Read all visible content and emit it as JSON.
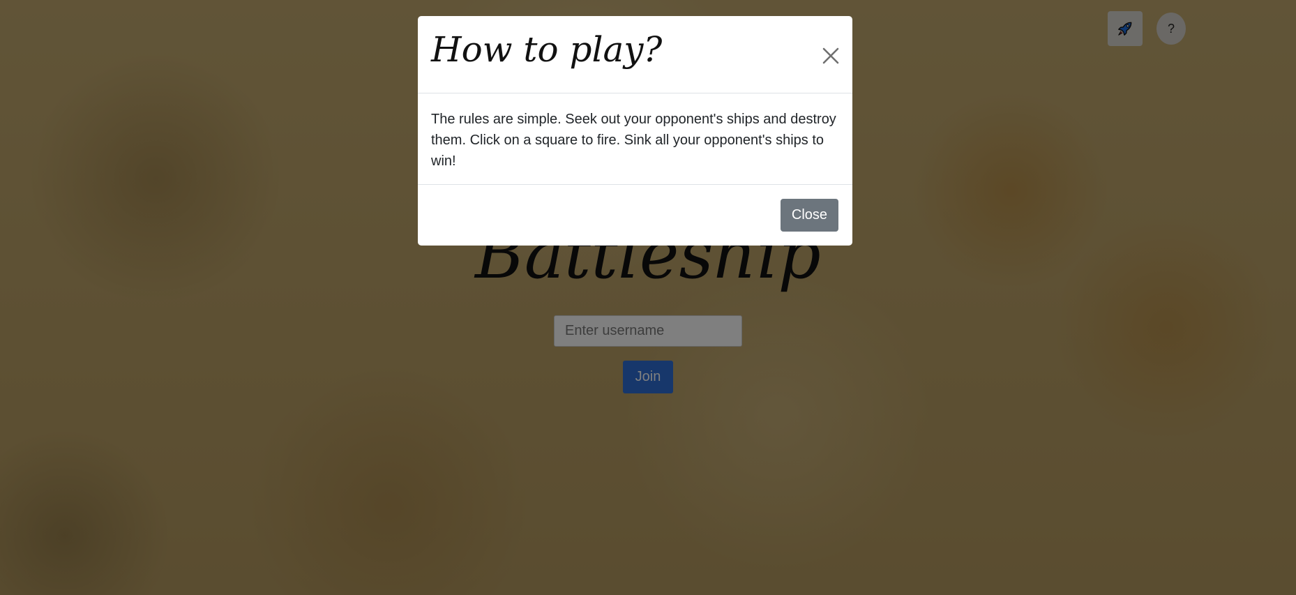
{
  "page": {
    "title": "Battleship",
    "username_placeholder": "Enter username",
    "join_label": "Join",
    "help_label": "?"
  },
  "icons": {
    "rocket": "rocket-icon",
    "close": "close-icon"
  },
  "modal": {
    "title": "How to play?",
    "body": "The rules are simple. Seek out your opponent's ships and destroy them. Click on a square to fire. Sink all your opponent's ships to win!",
    "close_label": "Close"
  },
  "colors": {
    "join_button": "#2f6fd6",
    "close_button": "#6c757d",
    "backdrop": "rgba(0,0,0,0.5)"
  }
}
